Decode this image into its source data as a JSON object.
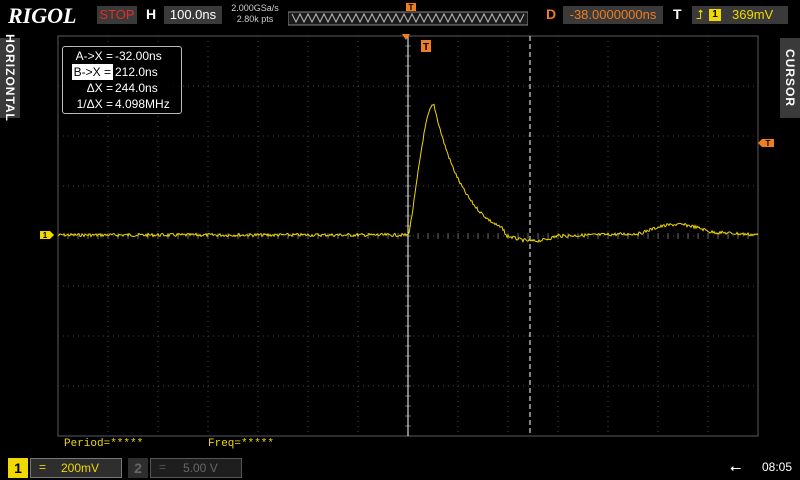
{
  "brand": "RIGOL",
  "top_bar": {
    "run_state": "STOP",
    "horizontal_label": "H",
    "timebase": "100.0ns",
    "sample_rate": "2.000GSa/s",
    "memory_depth": "2.80k pts",
    "delay_label": "D",
    "delay": "-38.0000000ns",
    "trigger_label": "T",
    "trigger_edge": "rising-edge-icon",
    "trigger_source": "1",
    "trigger_level": "369mV"
  },
  "side_tabs": {
    "left": "HORIZONTAL",
    "right": "CURSOR"
  },
  "cursor_readout": [
    {
      "key": "A->X =",
      "value": "-32.00ns",
      "selected": false
    },
    {
      "key": "B->X =",
      "value": "212.0ns",
      "selected": true
    },
    {
      "key": "ΔX =",
      "value": "244.0ns",
      "selected": false
    },
    {
      "key": "1/ΔX =",
      "value": "4.098MHz",
      "selected": false
    }
  ],
  "markers": {
    "trigger_top": "T",
    "trigger_level_right": "T",
    "channel1_ground": "1"
  },
  "measurements": {
    "period": "Period=*****",
    "freq": "Freq=*****"
  },
  "bottom_bar": {
    "ch1_number": "1",
    "ch1_coupling": "=",
    "ch1_scale": "200mV",
    "ch2_number": "2",
    "ch2_coupling": "=",
    "ch2_scale": "5.00 V",
    "clock": "08:05"
  },
  "colors": {
    "ch1": "#f0d800",
    "trigger": "#f07d1e",
    "stop": "#e0302a",
    "grid": "#4a4a4a"
  }
}
